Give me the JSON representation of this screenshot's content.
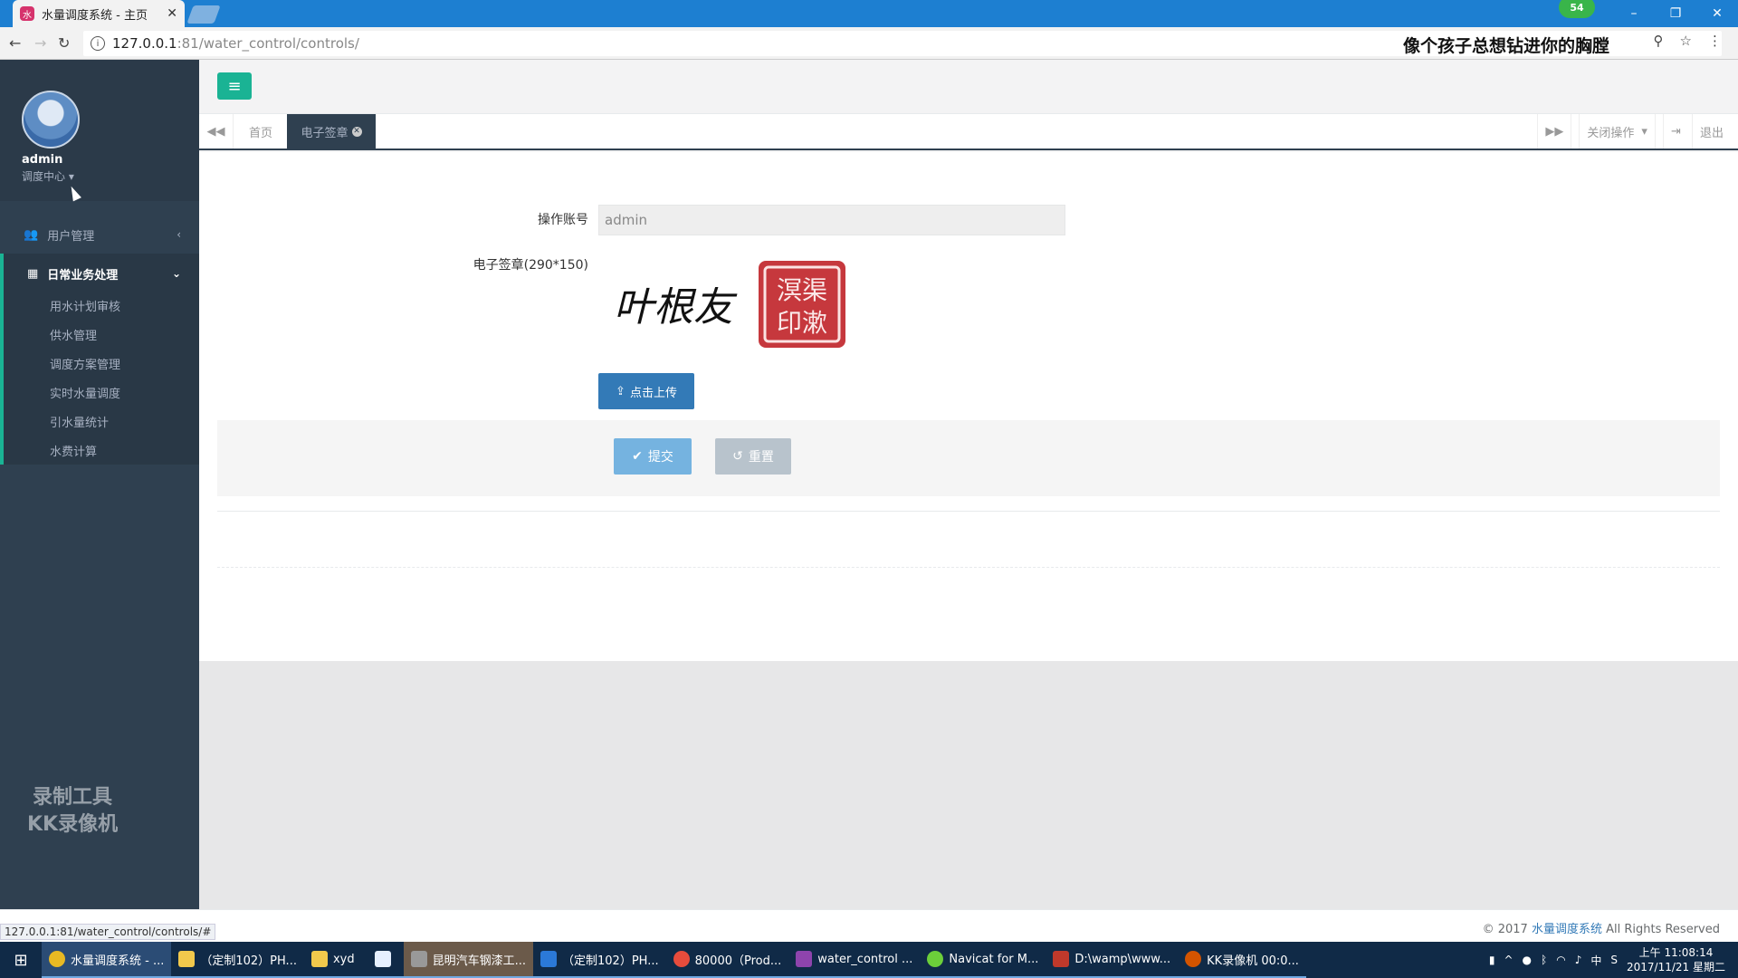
{
  "browser": {
    "tab_title": "水量调度系统 - 主页",
    "url_host": "127.0.0.1",
    "url_rest": ":81/water_control/controls/",
    "overlay_caption": "像个孩子总想钻进你的胸膛",
    "badge_count": "54",
    "status_url": "127.0.0.1:81/water_control/controls/#"
  },
  "sidebar": {
    "user_name": "admin",
    "user_role": "调度中心",
    "menu": [
      {
        "label": "用户管理",
        "icon": "users-icon",
        "expanded": false
      },
      {
        "label": "日常业务处理",
        "icon": "grid-icon",
        "expanded": true
      }
    ],
    "submenu": [
      "用水计划审核",
      "供水管理",
      "调度方案管理",
      "实时水量调度",
      "引水量统计",
      "水费计算"
    ],
    "watermark_line1": "录制工具",
    "watermark_line2": "KK录像机"
  },
  "tabs": {
    "home": "首页",
    "current": "电子签章",
    "close_ops": "关闭操作",
    "logout": "退出"
  },
  "form": {
    "account_label": "操作账号",
    "account_value": "admin",
    "signature_label": "电子签章(290*150)",
    "upload_label": "点击上传",
    "submit_label": "提交",
    "reset_label": "重置",
    "signature_text": "叶根友",
    "seal_text": "渠溟印漱"
  },
  "footer": {
    "prefix": "© 2017",
    "brand": "水量调度系统",
    "suffix": "All Rights Reserved"
  },
  "taskbar": {
    "apps": [
      "水量调度系统 - ...",
      "（定制102）PH...",
      "xyd",
      "",
      "昆明汽车钢漆工...",
      "（定制102）PH...",
      "80000（Prod...",
      "water_control ...",
      "Navicat for M...",
      "D:\\wamp\\www...",
      "KK录像机 00:0..."
    ],
    "ime": "中",
    "time": "上午 11:08:14",
    "date": "2017/11/21 星期二"
  },
  "colors": {
    "accent": "#1ab394",
    "sidebar_bg": "#2f4050",
    "primary": "#337ab7"
  }
}
